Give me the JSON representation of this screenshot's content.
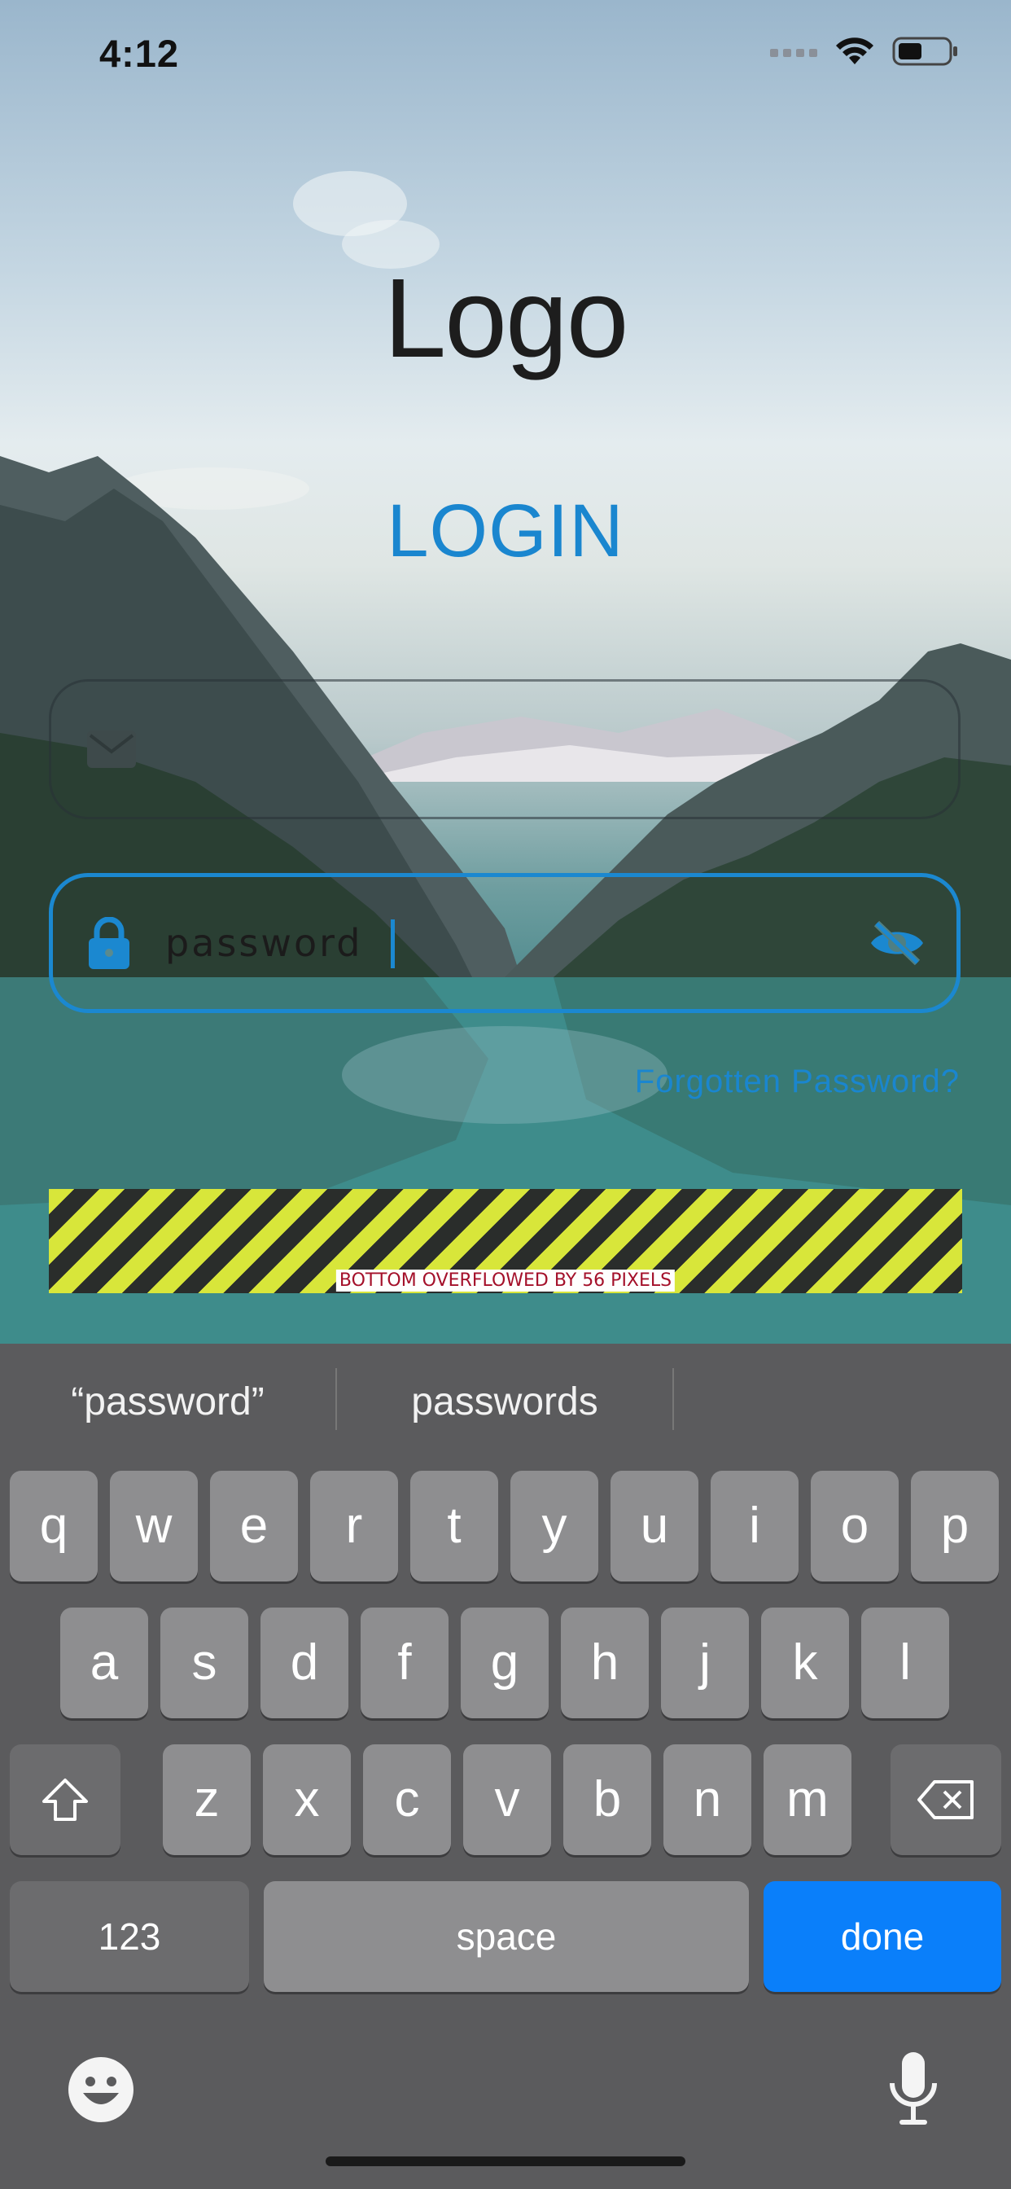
{
  "status_bar": {
    "time": "4:12",
    "icons": [
      "cellular-icon",
      "wifi-icon",
      "battery-icon"
    ]
  },
  "header": {
    "logo": "Logo",
    "title": "LOGIN"
  },
  "email_field": {
    "icon": "envelope-icon",
    "value": "",
    "placeholder": ""
  },
  "password_field": {
    "icon": "lock-icon",
    "value": "password",
    "toggle_icon": "eye-slash-icon"
  },
  "forgot_password": "Forgotten Password?",
  "overflow_warning": "BOTTOM OVERFLOWED BY 56 PIXELS",
  "keyboard": {
    "suggestions": [
      "“password”",
      "passwords",
      ""
    ],
    "row1": [
      "q",
      "w",
      "e",
      "r",
      "t",
      "y",
      "u",
      "i",
      "o",
      "p"
    ],
    "row2": [
      "a",
      "s",
      "d",
      "f",
      "g",
      "h",
      "j",
      "k",
      "l"
    ],
    "row3": [
      "z",
      "x",
      "c",
      "v",
      "b",
      "n",
      "m"
    ],
    "numbers_key": "123",
    "space_key": "space",
    "done_key": "done",
    "shift_icon": "shift-icon",
    "delete_icon": "delete-icon",
    "emoji_icon": "emoji-icon",
    "mic_icon": "microphone-icon"
  },
  "colors": {
    "accent": "#1a86cf",
    "done_key": "#0a7ffa",
    "keyboard_bg": "#5b5b5d",
    "key": "#8e8e90"
  }
}
